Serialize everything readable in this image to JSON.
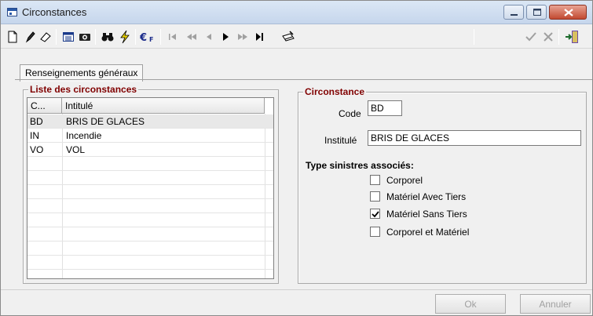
{
  "window": {
    "title": "Circonstances"
  },
  "tabs": [
    {
      "label": "Renseignements généraux"
    }
  ],
  "list_group": {
    "title": "Liste des circonstances",
    "columns": [
      "C...",
      "Intitulé"
    ],
    "rows": [
      {
        "code": "BD",
        "label": "BRIS DE GLACES"
      },
      {
        "code": "IN",
        "label": "Incendie"
      },
      {
        "code": "VO",
        "label": "VOL"
      }
    ]
  },
  "detail_group": {
    "title": "Circonstance",
    "code_label": "Code",
    "code_value": "BD",
    "intitule_label": "Institulé",
    "intitule_value": "BRIS DE GLACES",
    "sinistres_title": "Type sinistres associés:",
    "checkboxes": [
      {
        "label": "Corporel",
        "checked": false
      },
      {
        "label": "Matériel Avec Tiers",
        "checked": false
      },
      {
        "label": "Matériel Sans Tiers",
        "checked": true
      },
      {
        "label": "Corporel et Matériel",
        "checked": false
      }
    ]
  },
  "footer": {
    "ok_label": "Ok",
    "cancel_label": "Annuler"
  },
  "colors": {
    "group_title": "#800000",
    "close_button": "#c24a31"
  },
  "toolbar_icons": [
    "new-icon",
    "edit-pencil-icon",
    "eraser-icon",
    "calendar-icon",
    "camera-icon",
    "binoculars-icon",
    "lightning-icon",
    "euro-icon",
    "first-record-icon",
    "prev-page-icon",
    "prev-record-icon",
    "next-record-icon",
    "next-page-icon",
    "last-record-icon",
    "print-preview-icon",
    "validate-check-icon",
    "cancel-x-icon",
    "exit-door-icon"
  ]
}
